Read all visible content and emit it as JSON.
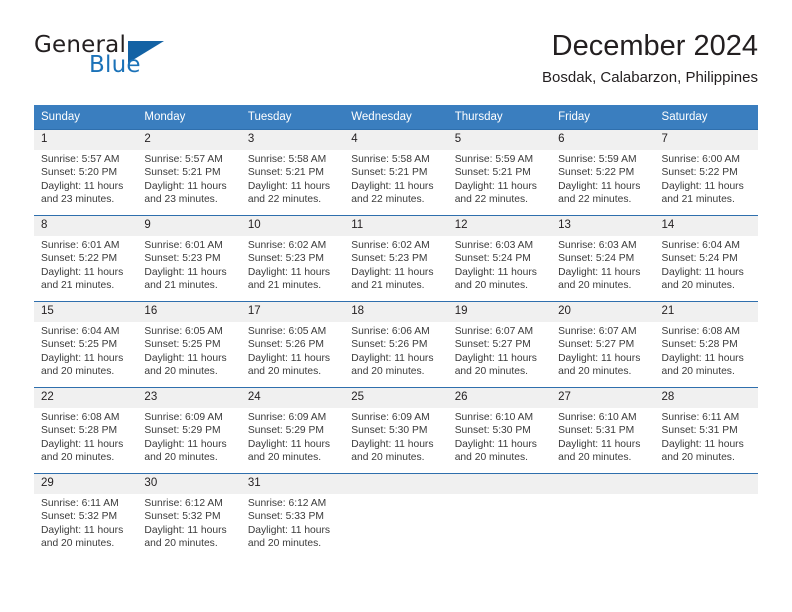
{
  "brand": {
    "name_part1": "General",
    "name_part2": "Blue",
    "triangle_color": "#1362a4",
    "blue_color": "#1b72b8"
  },
  "header": {
    "title": "December 2024",
    "subtitle": "Bosdak, Calabarzon, Philippines"
  },
  "theme": {
    "header_bg": "#3a7ebf",
    "row_divider": "#2f6fad",
    "daynum_bg": "#f0f0f0"
  },
  "weekday_headers": [
    "Sunday",
    "Monday",
    "Tuesday",
    "Wednesday",
    "Thursday",
    "Friday",
    "Saturday"
  ],
  "weeks": [
    [
      {
        "day": "1",
        "sunrise": "Sunrise: 5:57 AM",
        "sunset": "Sunset: 5:20 PM",
        "daylight1": "Daylight: 11 hours",
        "daylight2": "and 23 minutes."
      },
      {
        "day": "2",
        "sunrise": "Sunrise: 5:57 AM",
        "sunset": "Sunset: 5:21 PM",
        "daylight1": "Daylight: 11 hours",
        "daylight2": "and 23 minutes."
      },
      {
        "day": "3",
        "sunrise": "Sunrise: 5:58 AM",
        "sunset": "Sunset: 5:21 PM",
        "daylight1": "Daylight: 11 hours",
        "daylight2": "and 22 minutes."
      },
      {
        "day": "4",
        "sunrise": "Sunrise: 5:58 AM",
        "sunset": "Sunset: 5:21 PM",
        "daylight1": "Daylight: 11 hours",
        "daylight2": "and 22 minutes."
      },
      {
        "day": "5",
        "sunrise": "Sunrise: 5:59 AM",
        "sunset": "Sunset: 5:21 PM",
        "daylight1": "Daylight: 11 hours",
        "daylight2": "and 22 minutes."
      },
      {
        "day": "6",
        "sunrise": "Sunrise: 5:59 AM",
        "sunset": "Sunset: 5:22 PM",
        "daylight1": "Daylight: 11 hours",
        "daylight2": "and 22 minutes."
      },
      {
        "day": "7",
        "sunrise": "Sunrise: 6:00 AM",
        "sunset": "Sunset: 5:22 PM",
        "daylight1": "Daylight: 11 hours",
        "daylight2": "and 21 minutes."
      }
    ],
    [
      {
        "day": "8",
        "sunrise": "Sunrise: 6:01 AM",
        "sunset": "Sunset: 5:22 PM",
        "daylight1": "Daylight: 11 hours",
        "daylight2": "and 21 minutes."
      },
      {
        "day": "9",
        "sunrise": "Sunrise: 6:01 AM",
        "sunset": "Sunset: 5:23 PM",
        "daylight1": "Daylight: 11 hours",
        "daylight2": "and 21 minutes."
      },
      {
        "day": "10",
        "sunrise": "Sunrise: 6:02 AM",
        "sunset": "Sunset: 5:23 PM",
        "daylight1": "Daylight: 11 hours",
        "daylight2": "and 21 minutes."
      },
      {
        "day": "11",
        "sunrise": "Sunrise: 6:02 AM",
        "sunset": "Sunset: 5:23 PM",
        "daylight1": "Daylight: 11 hours",
        "daylight2": "and 21 minutes."
      },
      {
        "day": "12",
        "sunrise": "Sunrise: 6:03 AM",
        "sunset": "Sunset: 5:24 PM",
        "daylight1": "Daylight: 11 hours",
        "daylight2": "and 20 minutes."
      },
      {
        "day": "13",
        "sunrise": "Sunrise: 6:03 AM",
        "sunset": "Sunset: 5:24 PM",
        "daylight1": "Daylight: 11 hours",
        "daylight2": "and 20 minutes."
      },
      {
        "day": "14",
        "sunrise": "Sunrise: 6:04 AM",
        "sunset": "Sunset: 5:24 PM",
        "daylight1": "Daylight: 11 hours",
        "daylight2": "and 20 minutes."
      }
    ],
    [
      {
        "day": "15",
        "sunrise": "Sunrise: 6:04 AM",
        "sunset": "Sunset: 5:25 PM",
        "daylight1": "Daylight: 11 hours",
        "daylight2": "and 20 minutes."
      },
      {
        "day": "16",
        "sunrise": "Sunrise: 6:05 AM",
        "sunset": "Sunset: 5:25 PM",
        "daylight1": "Daylight: 11 hours",
        "daylight2": "and 20 minutes."
      },
      {
        "day": "17",
        "sunrise": "Sunrise: 6:05 AM",
        "sunset": "Sunset: 5:26 PM",
        "daylight1": "Daylight: 11 hours",
        "daylight2": "and 20 minutes."
      },
      {
        "day": "18",
        "sunrise": "Sunrise: 6:06 AM",
        "sunset": "Sunset: 5:26 PM",
        "daylight1": "Daylight: 11 hours",
        "daylight2": "and 20 minutes."
      },
      {
        "day": "19",
        "sunrise": "Sunrise: 6:07 AM",
        "sunset": "Sunset: 5:27 PM",
        "daylight1": "Daylight: 11 hours",
        "daylight2": "and 20 minutes."
      },
      {
        "day": "20",
        "sunrise": "Sunrise: 6:07 AM",
        "sunset": "Sunset: 5:27 PM",
        "daylight1": "Daylight: 11 hours",
        "daylight2": "and 20 minutes."
      },
      {
        "day": "21",
        "sunrise": "Sunrise: 6:08 AM",
        "sunset": "Sunset: 5:28 PM",
        "daylight1": "Daylight: 11 hours",
        "daylight2": "and 20 minutes."
      }
    ],
    [
      {
        "day": "22",
        "sunrise": "Sunrise: 6:08 AM",
        "sunset": "Sunset: 5:28 PM",
        "daylight1": "Daylight: 11 hours",
        "daylight2": "and 20 minutes."
      },
      {
        "day": "23",
        "sunrise": "Sunrise: 6:09 AM",
        "sunset": "Sunset: 5:29 PM",
        "daylight1": "Daylight: 11 hours",
        "daylight2": "and 20 minutes."
      },
      {
        "day": "24",
        "sunrise": "Sunrise: 6:09 AM",
        "sunset": "Sunset: 5:29 PM",
        "daylight1": "Daylight: 11 hours",
        "daylight2": "and 20 minutes."
      },
      {
        "day": "25",
        "sunrise": "Sunrise: 6:09 AM",
        "sunset": "Sunset: 5:30 PM",
        "daylight1": "Daylight: 11 hours",
        "daylight2": "and 20 minutes."
      },
      {
        "day": "26",
        "sunrise": "Sunrise: 6:10 AM",
        "sunset": "Sunset: 5:30 PM",
        "daylight1": "Daylight: 11 hours",
        "daylight2": "and 20 minutes."
      },
      {
        "day": "27",
        "sunrise": "Sunrise: 6:10 AM",
        "sunset": "Sunset: 5:31 PM",
        "daylight1": "Daylight: 11 hours",
        "daylight2": "and 20 minutes."
      },
      {
        "day": "28",
        "sunrise": "Sunrise: 6:11 AM",
        "sunset": "Sunset: 5:31 PM",
        "daylight1": "Daylight: 11 hours",
        "daylight2": "and 20 minutes."
      }
    ],
    [
      {
        "day": "29",
        "sunrise": "Sunrise: 6:11 AM",
        "sunset": "Sunset: 5:32 PM",
        "daylight1": "Daylight: 11 hours",
        "daylight2": "and 20 minutes."
      },
      {
        "day": "30",
        "sunrise": "Sunrise: 6:12 AM",
        "sunset": "Sunset: 5:32 PM",
        "daylight1": "Daylight: 11 hours",
        "daylight2": "and 20 minutes."
      },
      {
        "day": "31",
        "sunrise": "Sunrise: 6:12 AM",
        "sunset": "Sunset: 5:33 PM",
        "daylight1": "Daylight: 11 hours",
        "daylight2": "and 20 minutes."
      },
      {
        "day": "",
        "sunrise": "",
        "sunset": "",
        "daylight1": "",
        "daylight2": ""
      },
      {
        "day": "",
        "sunrise": "",
        "sunset": "",
        "daylight1": "",
        "daylight2": ""
      },
      {
        "day": "",
        "sunrise": "",
        "sunset": "",
        "daylight1": "",
        "daylight2": ""
      },
      {
        "day": "",
        "sunrise": "",
        "sunset": "",
        "daylight1": "",
        "daylight2": ""
      }
    ]
  ]
}
